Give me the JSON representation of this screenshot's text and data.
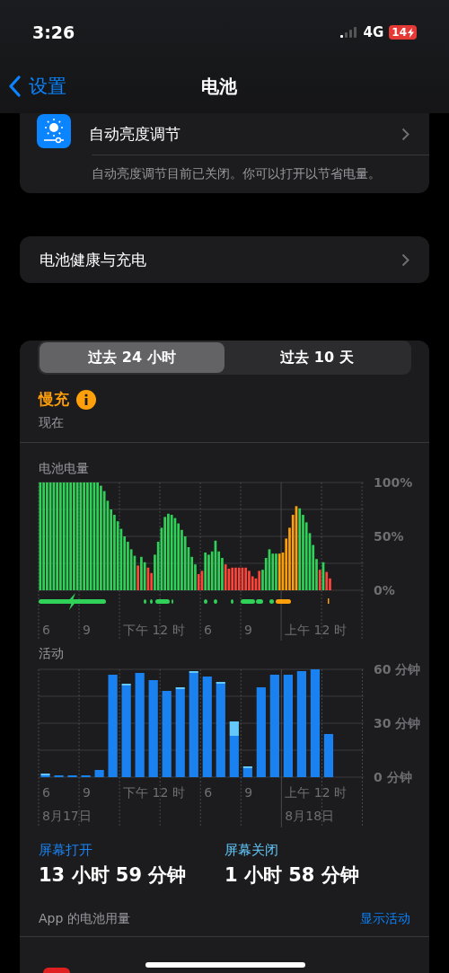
{
  "status_bar": {
    "time": "3:26",
    "network": "4G",
    "battery": "14"
  },
  "nav": {
    "back": "设置",
    "title": "电池"
  },
  "brightness": {
    "label": "自动亮度调节",
    "note": "自动亮度调节目前已关闭。你可以打开以节省电量。"
  },
  "health": {
    "label": "电池健康与充电"
  },
  "usage": {
    "tabs": [
      {
        "label": "过去 24 小时",
        "selected": true
      },
      {
        "label": "过去 10 天",
        "selected": false
      }
    ],
    "status": {
      "title": "慢充",
      "subtitle": "现在"
    },
    "battery_chart": {
      "title": "电池电量",
      "x_labels": [
        {
          "label": "6"
        },
        {
          "label": "9"
        },
        {
          "label": "下午 12 时"
        },
        {
          "label": "6"
        },
        {
          "label": "9"
        },
        {
          "label": "上午 12 时"
        }
      ],
      "chart_data": {
        "type": "bar",
        "ylim": [
          0,
          100
        ],
        "yticks": [
          {
            "value": 100,
            "label": "100%"
          },
          {
            "value": 50,
            "label": "50%"
          },
          {
            "value": 0,
            "label": "0%"
          }
        ],
        "series": [
          {
            "color": "#30d158",
            "values": [
              100,
              100,
              100,
              100,
              100,
              100,
              100,
              100,
              100,
              100,
              100,
              100,
              100,
              100,
              100,
              100,
              100,
              100,
              97,
              92,
              83,
              75,
              70,
              64,
              57,
              50,
              45,
              38,
              32,
              null,
              31,
              26,
              null,
              null,
              33,
              45,
              58,
              68,
              71,
              70,
              67,
              62,
              56,
              50,
              40,
              31,
              24,
              null,
              null,
              35,
              33,
              36,
              46,
              36,
              30,
              null,
              null,
              null,
              null,
              null,
              null,
              null,
              null,
              null,
              null,
              null,
              19,
              30,
              38,
              34,
              34,
              null,
              null,
              null,
              null,
              null,
              null,
              76,
              70,
              63,
              53,
              42,
              29,
              null,
              26,
              null,
              null,
              null,
              null,
              null,
              null,
              null,
              null,
              null,
              null
            ]
          },
          {
            "color": "#ff453a",
            "values": [
              null,
              null,
              null,
              null,
              null,
              null,
              null,
              null,
              null,
              null,
              null,
              null,
              null,
              null,
              null,
              null,
              null,
              null,
              null,
              null,
              null,
              null,
              null,
              null,
              null,
              null,
              null,
              null,
              null,
              23,
              null,
              null,
              21,
              16,
              null,
              null,
              null,
              null,
              null,
              null,
              null,
              null,
              null,
              null,
              null,
              null,
              null,
              15,
              18,
              null,
              null,
              null,
              null,
              null,
              null,
              24,
              20,
              21,
              21,
              21,
              21,
              21,
              18,
              13,
              11,
              18,
              null,
              null,
              null,
              null,
              null,
              null,
              null,
              null,
              null,
              null,
              null,
              null,
              null,
              null,
              null,
              null,
              null,
              19,
              null,
              17,
              11,
              null,
              null,
              null,
              null,
              null,
              null,
              null,
              null,
              null,
              null
            ]
          },
          {
            "color": "#ff9f0a",
            "values": [
              null,
              null,
              null,
              null,
              null,
              null,
              null,
              null,
              null,
              null,
              null,
              null,
              null,
              null,
              null,
              null,
              null,
              null,
              null,
              null,
              null,
              null,
              null,
              null,
              null,
              null,
              null,
              null,
              null,
              null,
              null,
              null,
              null,
              null,
              null,
              null,
              null,
              null,
              null,
              null,
              null,
              null,
              null,
              null,
              null,
              null,
              null,
              null,
              null,
              null,
              null,
              null,
              null,
              null,
              null,
              null,
              null,
              null,
              null,
              null,
              null,
              null,
              null,
              null,
              null,
              null,
              null,
              null,
              null,
              null,
              null,
              34,
              35,
              48,
              58,
              70,
              78,
              null,
              null,
              null,
              null,
              null,
              null,
              null,
              null,
              null,
              null,
              null,
              null,
              null,
              null,
              null,
              null,
              null,
              null,
              null,
              null
            ]
          }
        ]
      }
    },
    "activity_chart": {
      "title": "活动",
      "x_labels": [
        {
          "label": "6",
          "date": "8月17日"
        },
        {
          "label": "9"
        },
        {
          "label": "下午 12 时"
        },
        {
          "label": "6"
        },
        {
          "label": "9"
        },
        {
          "label": "上午 12 时",
          "date": "8月18日"
        }
      ],
      "chart_data": {
        "type": "bar",
        "stacked": true,
        "ylim": [
          0,
          60
        ],
        "yticks": [
          {
            "value": 60,
            "label": "60 分钟"
          },
          {
            "value": 30,
            "label": "30 分钟"
          },
          {
            "value": 0,
            "label": "0 分钟"
          }
        ],
        "series": [
          {
            "name": "屏幕打开",
            "color": "#1a82f0",
            "values": [
              1,
              1,
              1,
              1,
              4,
              57,
              51,
              58,
              54,
              48,
              49,
              58,
              56,
              52,
              23,
              5,
              50,
              57,
              57,
              59,
              60,
              24,
              null,
              null
            ]
          },
          {
            "name": "屏幕关闭",
            "color": "#64c8fa",
            "values": [
              1,
              null,
              null,
              null,
              null,
              null,
              1,
              null,
              null,
              null,
              1,
              1,
              null,
              1,
              8,
              1,
              null,
              null,
              null,
              null,
              null,
              null,
              null,
              null
            ]
          }
        ]
      }
    },
    "totals": [
      {
        "value": "13 小时 59 分钟"
      },
      {
        "value": "1 小时 58 分钟"
      }
    ],
    "app_usage": {
      "title": "App 的电池用量",
      "action": "显示活动"
    }
  }
}
